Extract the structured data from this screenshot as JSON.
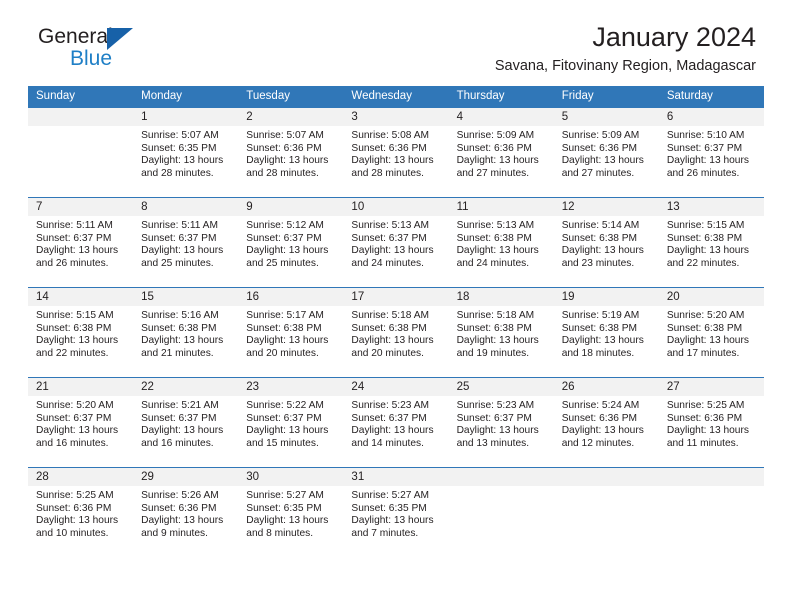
{
  "brand": {
    "name_top": "General",
    "name_bottom": "Blue",
    "triangle_color": "#1761a8",
    "blue_color": "#1f7fc6"
  },
  "header": {
    "title": "January 2024",
    "subtitle": "Savana, Fitovinany Region, Madagascar"
  },
  "theme": {
    "header_bg": "#3077b8",
    "daynum_bg": "#f2f2f2",
    "text": "#231f20"
  },
  "weekday_headers": [
    "Sunday",
    "Monday",
    "Tuesday",
    "Wednesday",
    "Thursday",
    "Friday",
    "Saturday"
  ],
  "labels": {
    "sunrise_prefix": "Sunrise: ",
    "sunset_prefix": "Sunset: ",
    "daylight_prefix": "Daylight: "
  },
  "weeks": [
    [
      {
        "empty": true
      },
      {
        "day": "1",
        "sunrise": "Sunrise: 5:07 AM",
        "sunset": "Sunset: 6:35 PM",
        "daylight1": "Daylight: 13 hours",
        "daylight2": "and 28 minutes."
      },
      {
        "day": "2",
        "sunrise": "Sunrise: 5:07 AM",
        "sunset": "Sunset: 6:36 PM",
        "daylight1": "Daylight: 13 hours",
        "daylight2": "and 28 minutes."
      },
      {
        "day": "3",
        "sunrise": "Sunrise: 5:08 AM",
        "sunset": "Sunset: 6:36 PM",
        "daylight1": "Daylight: 13 hours",
        "daylight2": "and 28 minutes."
      },
      {
        "day": "4",
        "sunrise": "Sunrise: 5:09 AM",
        "sunset": "Sunset: 6:36 PM",
        "daylight1": "Daylight: 13 hours",
        "daylight2": "and 27 minutes."
      },
      {
        "day": "5",
        "sunrise": "Sunrise: 5:09 AM",
        "sunset": "Sunset: 6:36 PM",
        "daylight1": "Daylight: 13 hours",
        "daylight2": "and 27 minutes."
      },
      {
        "day": "6",
        "sunrise": "Sunrise: 5:10 AM",
        "sunset": "Sunset: 6:37 PM",
        "daylight1": "Daylight: 13 hours",
        "daylight2": "and 26 minutes."
      }
    ],
    [
      {
        "day": "7",
        "sunrise": "Sunrise: 5:11 AM",
        "sunset": "Sunset: 6:37 PM",
        "daylight1": "Daylight: 13 hours",
        "daylight2": "and 26 minutes."
      },
      {
        "day": "8",
        "sunrise": "Sunrise: 5:11 AM",
        "sunset": "Sunset: 6:37 PM",
        "daylight1": "Daylight: 13 hours",
        "daylight2": "and 25 minutes."
      },
      {
        "day": "9",
        "sunrise": "Sunrise: 5:12 AM",
        "sunset": "Sunset: 6:37 PM",
        "daylight1": "Daylight: 13 hours",
        "daylight2": "and 25 minutes."
      },
      {
        "day": "10",
        "sunrise": "Sunrise: 5:13 AM",
        "sunset": "Sunset: 6:37 PM",
        "daylight1": "Daylight: 13 hours",
        "daylight2": "and 24 minutes."
      },
      {
        "day": "11",
        "sunrise": "Sunrise: 5:13 AM",
        "sunset": "Sunset: 6:38 PM",
        "daylight1": "Daylight: 13 hours",
        "daylight2": "and 24 minutes."
      },
      {
        "day": "12",
        "sunrise": "Sunrise: 5:14 AM",
        "sunset": "Sunset: 6:38 PM",
        "daylight1": "Daylight: 13 hours",
        "daylight2": "and 23 minutes."
      },
      {
        "day": "13",
        "sunrise": "Sunrise: 5:15 AM",
        "sunset": "Sunset: 6:38 PM",
        "daylight1": "Daylight: 13 hours",
        "daylight2": "and 22 minutes."
      }
    ],
    [
      {
        "day": "14",
        "sunrise": "Sunrise: 5:15 AM",
        "sunset": "Sunset: 6:38 PM",
        "daylight1": "Daylight: 13 hours",
        "daylight2": "and 22 minutes."
      },
      {
        "day": "15",
        "sunrise": "Sunrise: 5:16 AM",
        "sunset": "Sunset: 6:38 PM",
        "daylight1": "Daylight: 13 hours",
        "daylight2": "and 21 minutes."
      },
      {
        "day": "16",
        "sunrise": "Sunrise: 5:17 AM",
        "sunset": "Sunset: 6:38 PM",
        "daylight1": "Daylight: 13 hours",
        "daylight2": "and 20 minutes."
      },
      {
        "day": "17",
        "sunrise": "Sunrise: 5:18 AM",
        "sunset": "Sunset: 6:38 PM",
        "daylight1": "Daylight: 13 hours",
        "daylight2": "and 20 minutes."
      },
      {
        "day": "18",
        "sunrise": "Sunrise: 5:18 AM",
        "sunset": "Sunset: 6:38 PM",
        "daylight1": "Daylight: 13 hours",
        "daylight2": "and 19 minutes."
      },
      {
        "day": "19",
        "sunrise": "Sunrise: 5:19 AM",
        "sunset": "Sunset: 6:38 PM",
        "daylight1": "Daylight: 13 hours",
        "daylight2": "and 18 minutes."
      },
      {
        "day": "20",
        "sunrise": "Sunrise: 5:20 AM",
        "sunset": "Sunset: 6:38 PM",
        "daylight1": "Daylight: 13 hours",
        "daylight2": "and 17 minutes."
      }
    ],
    [
      {
        "day": "21",
        "sunrise": "Sunrise: 5:20 AM",
        "sunset": "Sunset: 6:37 PM",
        "daylight1": "Daylight: 13 hours",
        "daylight2": "and 16 minutes."
      },
      {
        "day": "22",
        "sunrise": "Sunrise: 5:21 AM",
        "sunset": "Sunset: 6:37 PM",
        "daylight1": "Daylight: 13 hours",
        "daylight2": "and 16 minutes."
      },
      {
        "day": "23",
        "sunrise": "Sunrise: 5:22 AM",
        "sunset": "Sunset: 6:37 PM",
        "daylight1": "Daylight: 13 hours",
        "daylight2": "and 15 minutes."
      },
      {
        "day": "24",
        "sunrise": "Sunrise: 5:23 AM",
        "sunset": "Sunset: 6:37 PM",
        "daylight1": "Daylight: 13 hours",
        "daylight2": "and 14 minutes."
      },
      {
        "day": "25",
        "sunrise": "Sunrise: 5:23 AM",
        "sunset": "Sunset: 6:37 PM",
        "daylight1": "Daylight: 13 hours",
        "daylight2": "and 13 minutes."
      },
      {
        "day": "26",
        "sunrise": "Sunrise: 5:24 AM",
        "sunset": "Sunset: 6:36 PM",
        "daylight1": "Daylight: 13 hours",
        "daylight2": "and 12 minutes."
      },
      {
        "day": "27",
        "sunrise": "Sunrise: 5:25 AM",
        "sunset": "Sunset: 6:36 PM",
        "daylight1": "Daylight: 13 hours",
        "daylight2": "and 11 minutes."
      }
    ],
    [
      {
        "day": "28",
        "sunrise": "Sunrise: 5:25 AM",
        "sunset": "Sunset: 6:36 PM",
        "daylight1": "Daylight: 13 hours",
        "daylight2": "and 10 minutes."
      },
      {
        "day": "29",
        "sunrise": "Sunrise: 5:26 AM",
        "sunset": "Sunset: 6:36 PM",
        "daylight1": "Daylight: 13 hours",
        "daylight2": "and 9 minutes."
      },
      {
        "day": "30",
        "sunrise": "Sunrise: 5:27 AM",
        "sunset": "Sunset: 6:35 PM",
        "daylight1": "Daylight: 13 hours",
        "daylight2": "and 8 minutes."
      },
      {
        "day": "31",
        "sunrise": "Sunrise: 5:27 AM",
        "sunset": "Sunset: 6:35 PM",
        "daylight1": "Daylight: 13 hours",
        "daylight2": "and 7 minutes."
      },
      {
        "empty": true
      },
      {
        "empty": true
      },
      {
        "empty": true
      }
    ]
  ]
}
